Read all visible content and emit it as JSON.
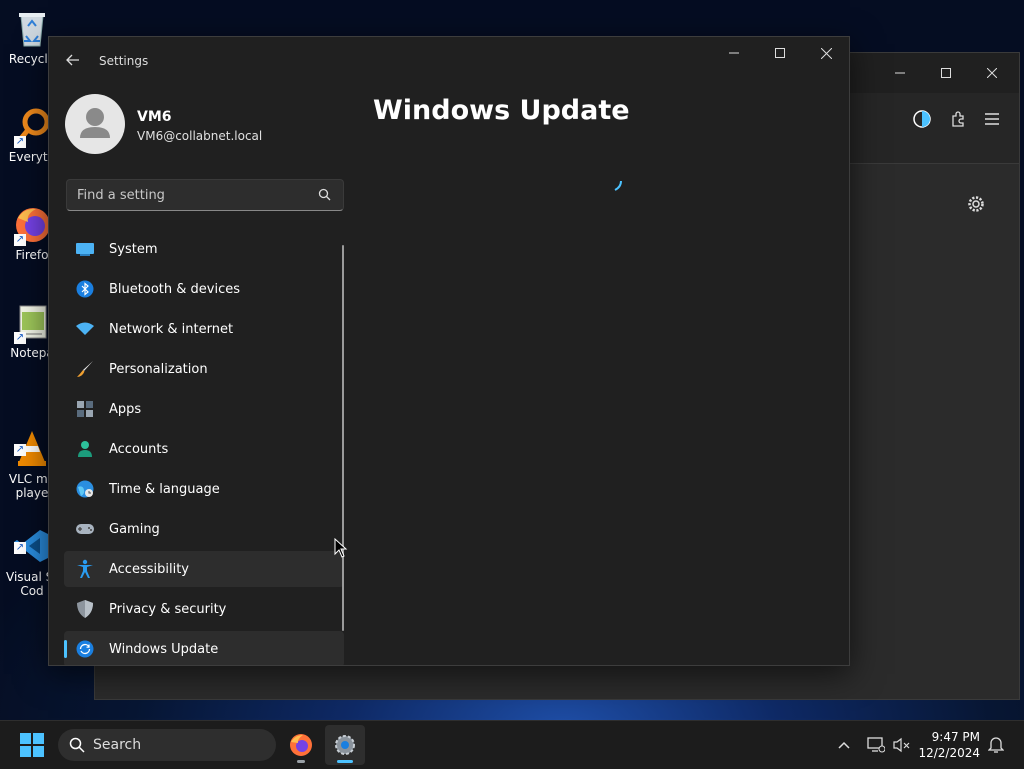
{
  "desktop": {
    "icons": [
      {
        "label": "Recycle",
        "icon": "recycle-bin-icon"
      },
      {
        "label": "Everyth",
        "icon": "everything-search-icon"
      },
      {
        "label": "Firefo",
        "icon": "firefox-icon"
      },
      {
        "label": "Notepa",
        "icon": "notepad-icon"
      },
      {
        "label": "VLC me\nplaye",
        "icon": "vlc-icon"
      },
      {
        "label": "Visual St\nCod",
        "icon": "vscode-icon"
      }
    ]
  },
  "settings": {
    "app_title": "Settings",
    "user": {
      "name": "VM6",
      "email": "VM6@collabnet.local"
    },
    "search_placeholder": "Find a setting",
    "nav": [
      {
        "label": "System",
        "icon": "system-icon"
      },
      {
        "label": "Bluetooth & devices",
        "icon": "bluetooth-icon"
      },
      {
        "label": "Network & internet",
        "icon": "wifi-icon"
      },
      {
        "label": "Personalization",
        "icon": "brush-icon"
      },
      {
        "label": "Apps",
        "icon": "apps-icon"
      },
      {
        "label": "Accounts",
        "icon": "accounts-icon"
      },
      {
        "label": "Time & language",
        "icon": "globe-clock-icon"
      },
      {
        "label": "Gaming",
        "icon": "gamepad-icon"
      },
      {
        "label": "Accessibility",
        "icon": "accessibility-icon"
      },
      {
        "label": "Privacy & security",
        "icon": "shield-icon"
      },
      {
        "label": "Windows Update",
        "icon": "windows-update-icon"
      }
    ],
    "selected": "Windows Update",
    "hovered": "Accessibility",
    "page_title": "Windows Update"
  },
  "taskbar": {
    "search_label": "Search",
    "time": "9:47 PM",
    "date": "12/2/2024"
  },
  "colors": {
    "accent": "#4cc2ff",
    "window_bg": "#202020",
    "taskbar_bg": "#1c1c1c"
  }
}
